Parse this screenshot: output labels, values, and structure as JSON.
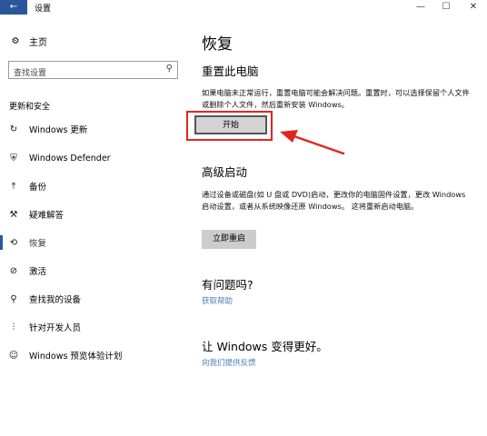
{
  "window": {
    "back_glyph": "←",
    "title": "设置",
    "min_glyph": "—",
    "max_glyph": "☐",
    "close_glyph": "✕"
  },
  "sidebar": {
    "home_label": "主页",
    "search_placeholder": "查找设置",
    "section_title": "更新和安全",
    "items": [
      {
        "label": "Windows 更新",
        "icon": "refresh-icon",
        "glyph": "↻"
      },
      {
        "label": "Windows Defender",
        "icon": "shield-icon",
        "glyph": "⛨"
      },
      {
        "label": "备份",
        "icon": "backup-icon",
        "glyph": "⤒"
      },
      {
        "label": "疑难解答",
        "icon": "wrench-icon",
        "glyph": "⚒"
      },
      {
        "label": "恢复",
        "icon": "recovery-icon",
        "glyph": "⟲"
      },
      {
        "label": "激活",
        "icon": "check-circle-icon",
        "glyph": "⊘"
      },
      {
        "label": "查找我的设备",
        "icon": "person-device-icon",
        "glyph": "⚲"
      },
      {
        "label": "针对开发人员",
        "icon": "developer-icon",
        "glyph": "⫶"
      },
      {
        "label": "Windows 预览体验计划",
        "icon": "insider-icon",
        "glyph": "☺"
      }
    ],
    "active_index": 4
  },
  "main": {
    "page_title": "恢复",
    "reset": {
      "heading": "重置此电脑",
      "description": "如果电脑未正常运行，重置电脑可能会解决问题。重置时，可以选择保留个人文件或删除个人文件，然后重新安装 Windows。",
      "button_label": "开始"
    },
    "advanced": {
      "heading": "高级启动",
      "description": "通过设备或磁盘(如 U 盘或 DVD)启动，更改你的电脑固件设置，更改 Windows 启动设置，或者从系统映像还原 Windows。 这将重新启动电脑。",
      "button_label": "立即重启"
    },
    "help": {
      "heading": "有问题吗?",
      "link": "获取帮助"
    },
    "feedback": {
      "heading": "让 Windows 变得更好。",
      "link": "向我们提供反馈"
    }
  },
  "colors": {
    "accent": "#2b579a",
    "link": "#4d7fb8",
    "annotation": "#e0261f",
    "button": "#cccccc"
  }
}
